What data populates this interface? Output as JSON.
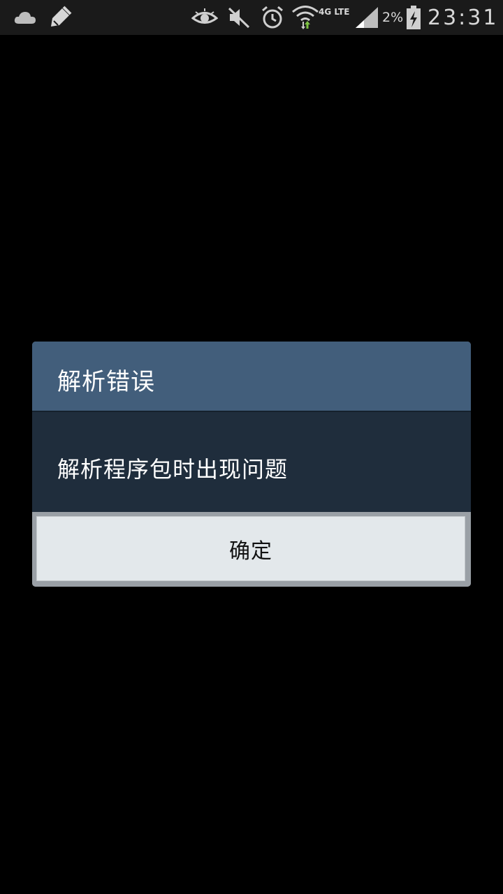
{
  "status_bar": {
    "icons_left": [
      "cloud-icon",
      "brush-icon"
    ],
    "icons_right": [
      "eye-icon",
      "mute-icon",
      "alarm-icon",
      "wifi-icon",
      "signal-icon",
      "battery-charging-icon"
    ],
    "network_label": "4G LTE",
    "battery_percent": "2%",
    "time": "23:31",
    "data_arrow_color": "#7ec242"
  },
  "dialog": {
    "title": "解析错误",
    "message": "解析程序包时出现问题",
    "ok_label": "确定",
    "colors": {
      "title_bg": "#425e7b",
      "body_bg": "#1f2d3c",
      "button_bg": "#e3e8eb"
    }
  }
}
